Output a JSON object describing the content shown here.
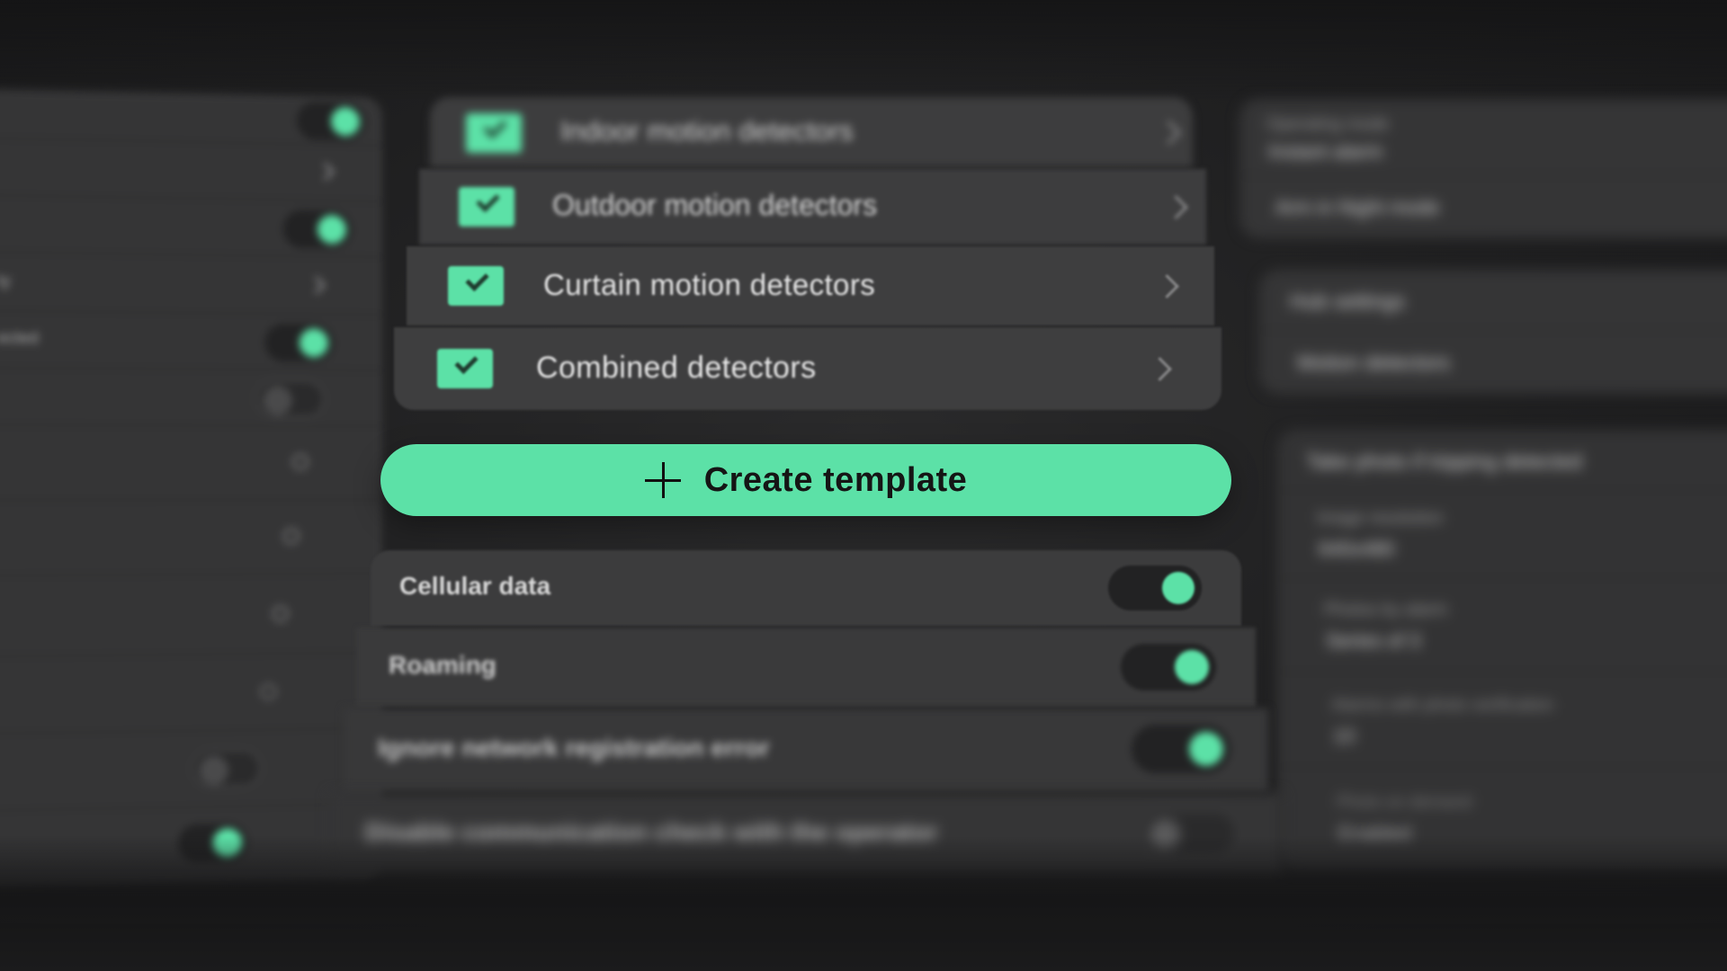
{
  "detectors": {
    "items": [
      {
        "label": "Indoor motion detectors",
        "checked": true
      },
      {
        "label": "Outdoor motion detectors",
        "checked": true
      },
      {
        "label": "Curtain motion detectors",
        "checked": true
      },
      {
        "label": "Combined detectors",
        "checked": true
      }
    ]
  },
  "create_button": {
    "label": "Create template"
  },
  "cellular": {
    "items": [
      {
        "label": "Cellular data",
        "on": true
      },
      {
        "label": "Roaming",
        "on": true
      },
      {
        "label": "Ignore network registration error",
        "on": true
      },
      {
        "label": "Disable communication check with the operator",
        "on": false
      }
    ]
  },
  "left_panel": {
    "items": [
      {
        "label": "",
        "control": "toggle-on"
      },
      {
        "label": "",
        "control": "chevron"
      },
      {
        "label": "",
        "control": "toggle-on"
      },
      {
        "label": "ty",
        "control": "chevron"
      },
      {
        "label": "ected",
        "control": "toggle-on"
      },
      {
        "label": "",
        "control": "toggle-off"
      },
      {
        "label": "",
        "control": "spinner"
      },
      {
        "label": "",
        "control": "spinner"
      },
      {
        "label": "",
        "control": "spinner"
      },
      {
        "label": "",
        "control": "spinner"
      },
      {
        "label": "",
        "control": "toggle-off"
      },
      {
        "label": "",
        "control": "toggle-on"
      }
    ]
  },
  "right_top": {
    "operating_mode_label": "Operating mode",
    "operating_mode_value": "Instant alarm",
    "night_mode_label": "Arm in Night mode"
  },
  "right_mid": {
    "items": [
      "Hub settings",
      "Motion detectors"
    ]
  },
  "right_bottom": {
    "title": "Take photo if tripping detected",
    "image_resolution_label": "Image resolution",
    "image_resolution_value": "640x480",
    "photos_label": "Photos by alarm",
    "photos_value": "Series of 3",
    "alarms_label": "Alarms with photo verification",
    "alarms_value": "10",
    "photo_label": "Photo on demand",
    "photo_value": "Enabled"
  },
  "colors": {
    "accent": "#5ce1a7",
    "panel": "#3a3a3b",
    "background": "#1d1d1e"
  }
}
